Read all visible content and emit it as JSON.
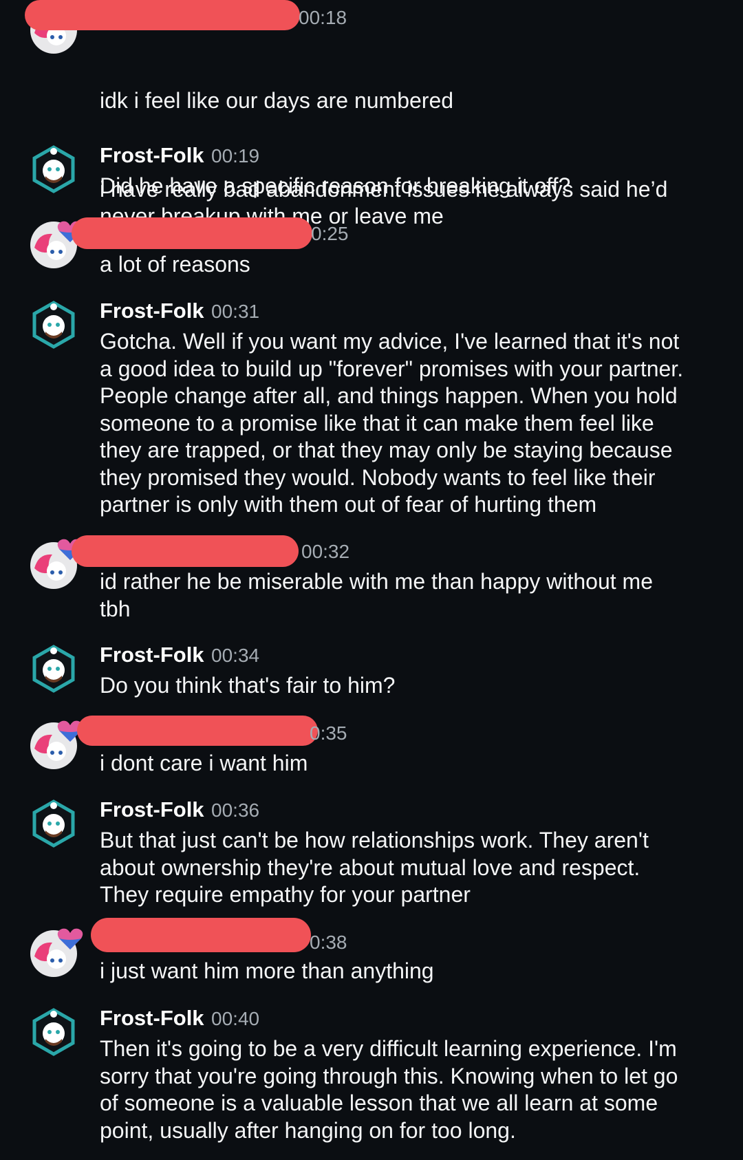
{
  "messages": [
    {
      "author": "",
      "time": "00:18",
      "redacted": true,
      "lines": [
        "idk i feel like our days are numbered",
        "i have really bad abandonment issues he always said he’d\nnever breakup with me or leave me"
      ]
    },
    {
      "author": "Frost-Folk",
      "time": "00:19",
      "lines": [
        "Did he have a specific reason for breaking it off?"
      ]
    },
    {
      "author": "",
      "time": "0:25",
      "redacted": true,
      "lines": [
        "a lot of reasons"
      ]
    },
    {
      "author": "Frost-Folk",
      "time": "00:31",
      "lines": [
        "Gotcha. Well if you want my advice, I've learned that it's not\na good idea to build up \"forever\" promises with your partner.\nPeople change after all, and things happen. When you hold\nsomeone to a promise like that it can make them feel like\nthey are trapped, or that they may only be staying because\nthey promised they would. Nobody wants to feel like their\npartner is only with them out of fear of hurting them"
      ]
    },
    {
      "author": "",
      "time": "00:32",
      "redacted": true,
      "lines": [
        "id rather he be miserable with me than happy without me\ntbh"
      ]
    },
    {
      "author": "Frost-Folk",
      "time": "00:34",
      "lines": [
        "Do you think that's fair to him?"
      ]
    },
    {
      "author": "",
      "time": "0:35",
      "redacted": true,
      "lines": [
        "i dont care i want him"
      ]
    },
    {
      "author": "Frost-Folk",
      "time": "00:36",
      "lines": [
        "But that just can't be how relationships work. They aren't\nabout ownership they're about mutual love and respect.\nThey require empathy for your partner"
      ]
    },
    {
      "author": "",
      "time": "0:38",
      "redacted": true,
      "lines": [
        "i just want him more than anything"
      ]
    },
    {
      "author": "Frost-Folk",
      "time": "00:40",
      "lines": [
        "Then it's going to be a very difficult learning experience. I'm\nsorry that you're going through this. Knowing when to let go\nof someone is a valuable lesson that we all learn at some\npoint, usually after hanging on for too long."
      ]
    }
  ],
  "colors": {
    "background": "#0b0e12",
    "redaction": "#f05257",
    "timestamp": "#a5acb3",
    "frost_avatar": "#2aa7a9"
  },
  "icons": {
    "frost_avatar": "snowman-bot-avatar-icon",
    "other_avatar": "pink-hair-avatar-icon",
    "heart": "bi-heart-icon"
  }
}
